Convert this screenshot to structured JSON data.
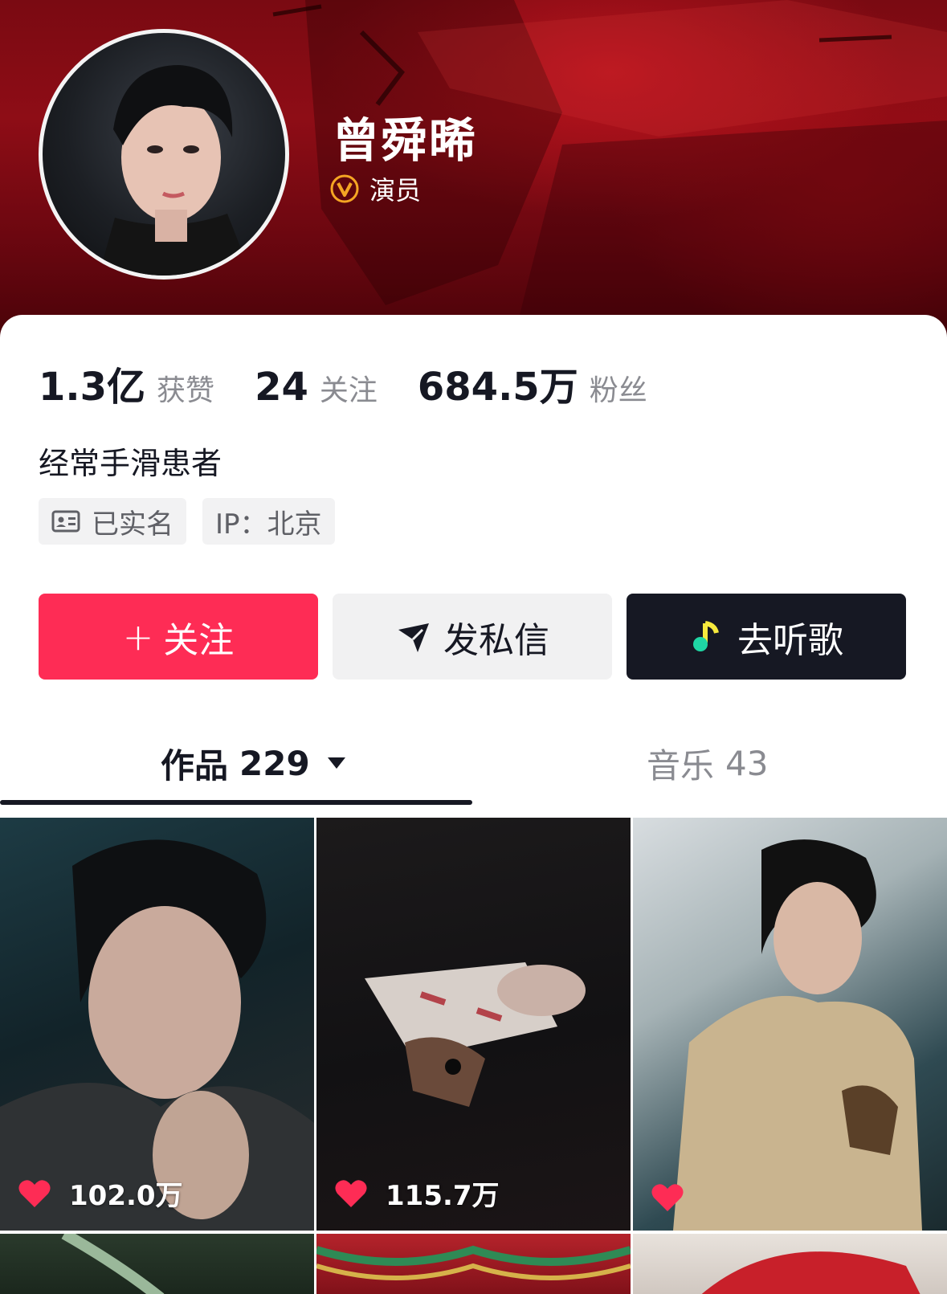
{
  "profile": {
    "name": "曾舜晞",
    "verify_label": "演员"
  },
  "stats": [
    {
      "value": "1.3亿",
      "label": "获赞"
    },
    {
      "value": "24",
      "label": "关注"
    },
    {
      "value": "684.5万",
      "label": "粉丝"
    }
  ],
  "bio": "经常手滑患者",
  "tags": {
    "realname": "已实名",
    "ip": "IP：北京"
  },
  "actions": {
    "follow": "关注",
    "follow_symbol": "+",
    "message": "发私信",
    "music": "去听歌"
  },
  "tabs": {
    "works_label": "作品",
    "works_count": "229",
    "music_label": "音乐",
    "music_count": "43"
  },
  "videos": [
    {
      "likes": "102.0万"
    },
    {
      "likes": "115.7万"
    },
    {
      "likes": ""
    }
  ],
  "colors": {
    "accent": "#fe2c55",
    "dark": "#161823",
    "banner": "#8e0d16",
    "verify": "#f5a623"
  }
}
